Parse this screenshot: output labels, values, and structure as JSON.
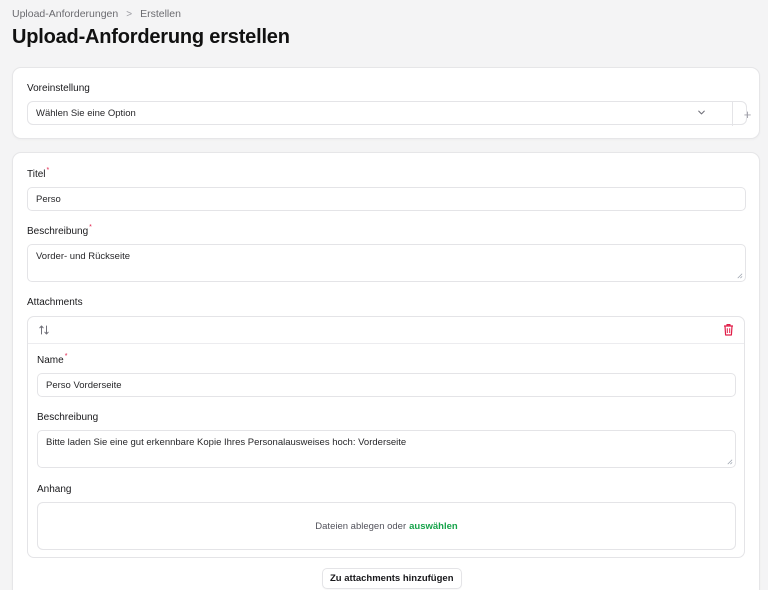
{
  "breadcrumb": {
    "parent": "Upload-Anforderungen",
    "current": "Erstellen"
  },
  "page_title": "Upload-Anforderung erstellen",
  "preset": {
    "label": "Voreinstellung",
    "value": "Wählen Sie eine Option",
    "add_symbol": "+"
  },
  "form": {
    "title_label": "Titel",
    "title_value": "Perso",
    "description_label": "Beschreibung",
    "description_value": "Vorder- und Rückseite",
    "required_mark": "*",
    "attachments_label": "Attachments",
    "attachment": {
      "name_label": "Name",
      "name_value": "Perso Vorderseite",
      "description_label": "Beschreibung",
      "description_value": "Bitte laden Sie eine gut erkennbare Kopie Ihres Personalausweises hoch: Vorderseite",
      "file_label": "Anhang",
      "dropzone_text": "Dateien ablegen oder",
      "dropzone_link": "auswählen"
    },
    "add_attachment_label": "Zu attachments hinzufügen"
  },
  "colors": {
    "accent_green": "#16a34a",
    "danger_red": "#e11d48",
    "background": "#f4f4f5"
  }
}
